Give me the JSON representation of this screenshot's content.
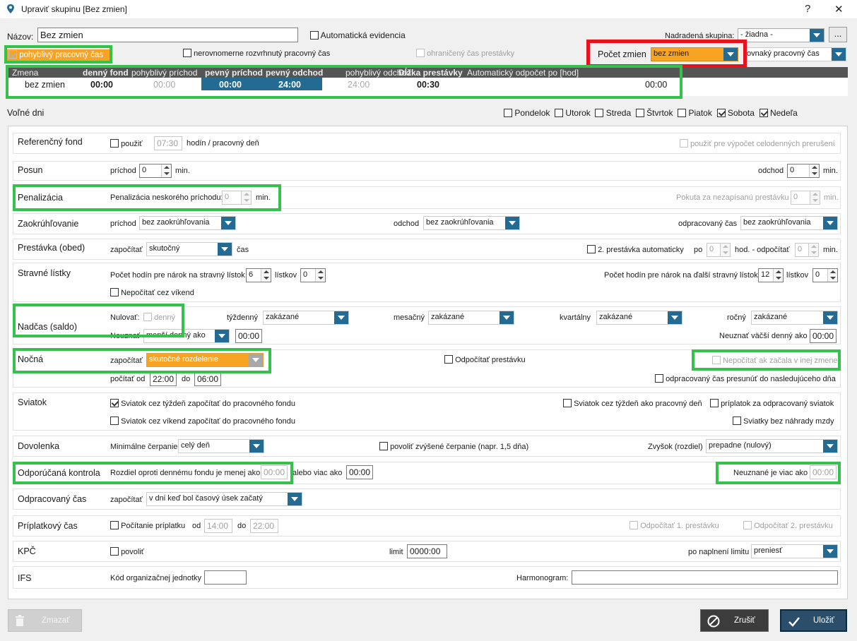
{
  "window": {
    "title": "Upraviť skupinu [Bez zmien]",
    "help": "?",
    "close": "✕"
  },
  "header": {
    "name_label": "Názov:",
    "name_value": "Bez zmien",
    "auto_evid": "Automatická evidencia",
    "parent_label": "Nadradená skupina:",
    "parent_value": "- žiadna -",
    "more": "...",
    "flex_time": "pohyblivý pracovný čas",
    "uneven_time": "nerovnomerne rozvrhnutý pracovný čas",
    "limited_break": "ohraničený čas prestávky",
    "shift_count_label": "Počet zmien",
    "shift_count_value": "bez zmien",
    "same_time_value": "ovnaký pracovný čas"
  },
  "grid": {
    "headers": [
      "Zmena",
      "denný fond",
      "pohyblivý príchod",
      "pevný príchod",
      "pevný odchod",
      "pohyblivý odchod",
      "Dĺžka prestávky",
      "Automatický odpočet po [hod]"
    ],
    "row": [
      "bez zmien",
      "00:00",
      "00:00",
      "00:00",
      "24:00",
      "24:00",
      "00:30",
      "00:00"
    ]
  },
  "free_days": {
    "label": "Voľné dni",
    "days": [
      {
        "name": "Pondelok",
        "checked": false
      },
      {
        "name": "Utorok",
        "checked": false
      },
      {
        "name": "Streda",
        "checked": false
      },
      {
        "name": "Štvrtok",
        "checked": false
      },
      {
        "name": "Piatok",
        "checked": false
      },
      {
        "name": "Sobota",
        "checked": true
      },
      {
        "name": "Nedeľa",
        "checked": true
      }
    ]
  },
  "ref": {
    "title": "Referenčný fond",
    "use": "použiť",
    "hours": "07:30",
    "unit": "hodín / pracovný deň",
    "full_day": "použiť pre výpočet celodenných prerušení"
  },
  "shift": {
    "title": "Posun",
    "arrive": "príchod",
    "arrive_val": "0",
    "min1": "min.",
    "leave": "odchod",
    "leave_val": "0",
    "min2": "min."
  },
  "penalty": {
    "title": "Penalizácia",
    "late": "Penalizácia neskorého príchodu:",
    "late_val": "0",
    "min1": "min.",
    "unrec": "Pokuta za nezapísanú prestávku",
    "unrec_val": "0",
    "min2": "min."
  },
  "round": {
    "title": "Zaokrúhľovanie",
    "arrive": "príchod",
    "arrive_val": "bez zaokrúhľovania",
    "leave": "odchod",
    "leave_val": "bez zaokrúhľovania",
    "worked": "odpracovaný čas",
    "worked_val": "bez zaokrúhľovania"
  },
  "break": {
    "title": "Prestávka (obed)",
    "count": "započítať",
    "count_val": "skutočný",
    "time": "čas",
    "second": "2. prestávka automaticky",
    "after": "po",
    "after_val": "0",
    "hod": "hod. - odpočítať",
    "sub_val": "0",
    "min": "min."
  },
  "meal": {
    "title": "Stravné lístky",
    "hours_label": "Počet hodín pre nárok na stravný lístok",
    "hours_val": "6",
    "tickets": "lístkov",
    "tickets_val": "0",
    "next_label": "Počet hodín pre nárok na ďalší stravný lístok",
    "next_val": "12",
    "tickets2": "lístkov",
    "tickets2_val": "0",
    "weekend": "Nepočítať cez víkend"
  },
  "overtime": {
    "title": "Nadčas (saldo)",
    "reset": "Nulovať:",
    "daily": "denný",
    "weekly": "týždenný",
    "weekly_val": "zakázané",
    "monthly": "mesačný",
    "monthly_val": "zakázané",
    "quarterly": "kvartálny",
    "quarterly_val": "zakázané",
    "yearly": "ročný",
    "yearly_val": "zakázané",
    "ignore": "Neuznať",
    "ignore_val": "menší denný ako",
    "ignore_time": "00:00",
    "ignore_more": "Neuznať väčší denný ako",
    "ignore_more_val": "00:00"
  },
  "night": {
    "title": "Nočná",
    "count": "započítať",
    "count_val": "skutočné rozdelenie",
    "sub_break": "Odpočítať prestávku",
    "other_shift": "Nepočítať ak začala v inej zmene",
    "from": "počítať od",
    "from_val": "22:00",
    "to": "do",
    "to_val": "06:00",
    "move": "odpracovaný čas presunúť do nasledujúceho dňa"
  },
  "holiday": {
    "title": "Sviatok",
    "c1": "Sviatok cez týždeň započítať do pracovného fondu",
    "c2": "Sviatok cez týždeň ako pracovný deň",
    "c3": "príplatok za odpracovaný sviatok",
    "c4": "Sviatok cez víkend započítať do pracovného fondu",
    "c5": "Sviatky bez náhrady mzdy"
  },
  "vacation": {
    "title": "Dovolenka",
    "min": "Minimálne čerpanie",
    "min_val": "celý deň",
    "raised": "povoliť zvýšené čerpanie (napr. 1,5 dňa)",
    "rest": "Zvyšok (rozdiel)",
    "rest_val": "prepadne (nulový)"
  },
  "control": {
    "title": "Odporúčaná kontrola",
    "diff": "Rozdiel oproti dennému fondu je menej ako",
    "diff_val": "00:00",
    "or": "alebo viac ako",
    "or_val": "00:00",
    "unrec": "Neuznané je viac ako",
    "unrec_val": "00:00"
  },
  "worked": {
    "title": "Odpracovaný čas",
    "count": "započítať",
    "count_val": "v dni keď bol časový úsek  začatý"
  },
  "bonus": {
    "title": "Príplatkový čas",
    "calc": "Počítanie príplatku",
    "from": "od",
    "from_val": "14:00",
    "to": "do",
    "to_val": "22:00",
    "b1": "Odpočítať 1. prestávku",
    "b2": "Odpočítať 2. prestávku"
  },
  "kpc": {
    "title": "KPČ",
    "allow": "povoliť",
    "limit": "limit",
    "limit_val": "0000:00",
    "after": "po naplnení limitu",
    "after_val": "preniesť"
  },
  "ifs": {
    "title": "IFS",
    "code": "Kód organizačnej jednotky",
    "code_val": "",
    "harmo": "Harmonogram:",
    "harmo_val": ""
  },
  "footer": {
    "delete": "Zmazať",
    "cancel": "Zrušiť",
    "save": "Uložiť"
  },
  "colors": {
    "accent": "#236b92",
    "highlight_orange": "#f7a425",
    "green_box": "#35c14b",
    "red_box": "#e8121d"
  }
}
